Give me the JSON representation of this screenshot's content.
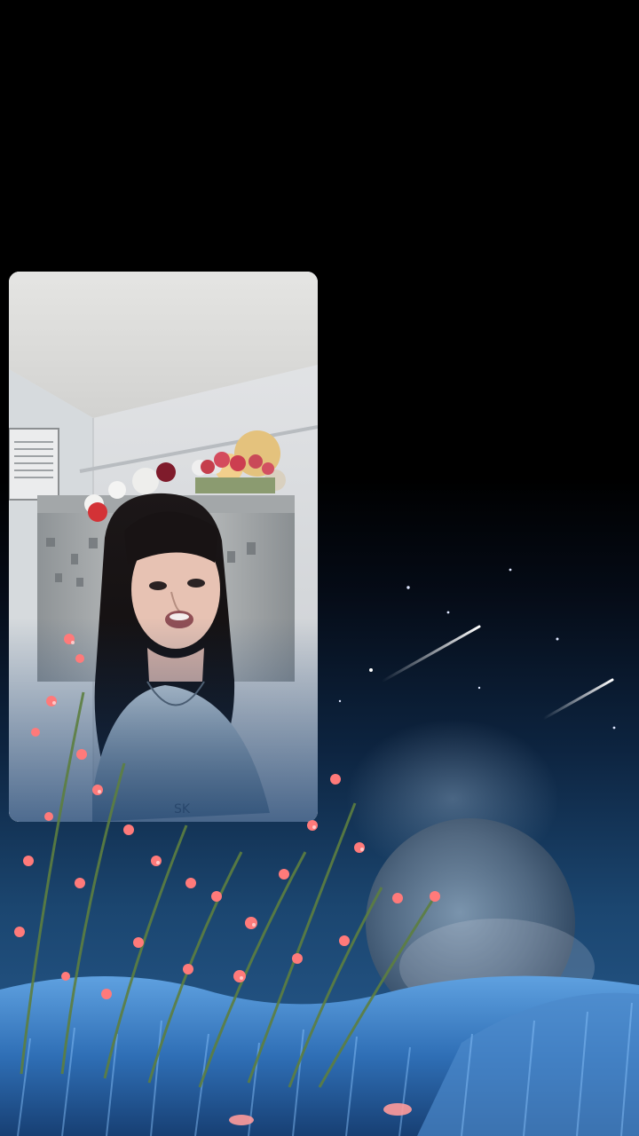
{
  "scene": {
    "background_color": "#000000",
    "sky_color": "#0d2440",
    "grass_color": "#2f6fb6",
    "flower_color": "#ff7a7a",
    "video_background_color": "#d9d9d8"
  },
  "icons": {
    "moon": "moon-icon",
    "shooting_star": "shooting-star-icon",
    "flowers": "flower-cluster-icon"
  }
}
